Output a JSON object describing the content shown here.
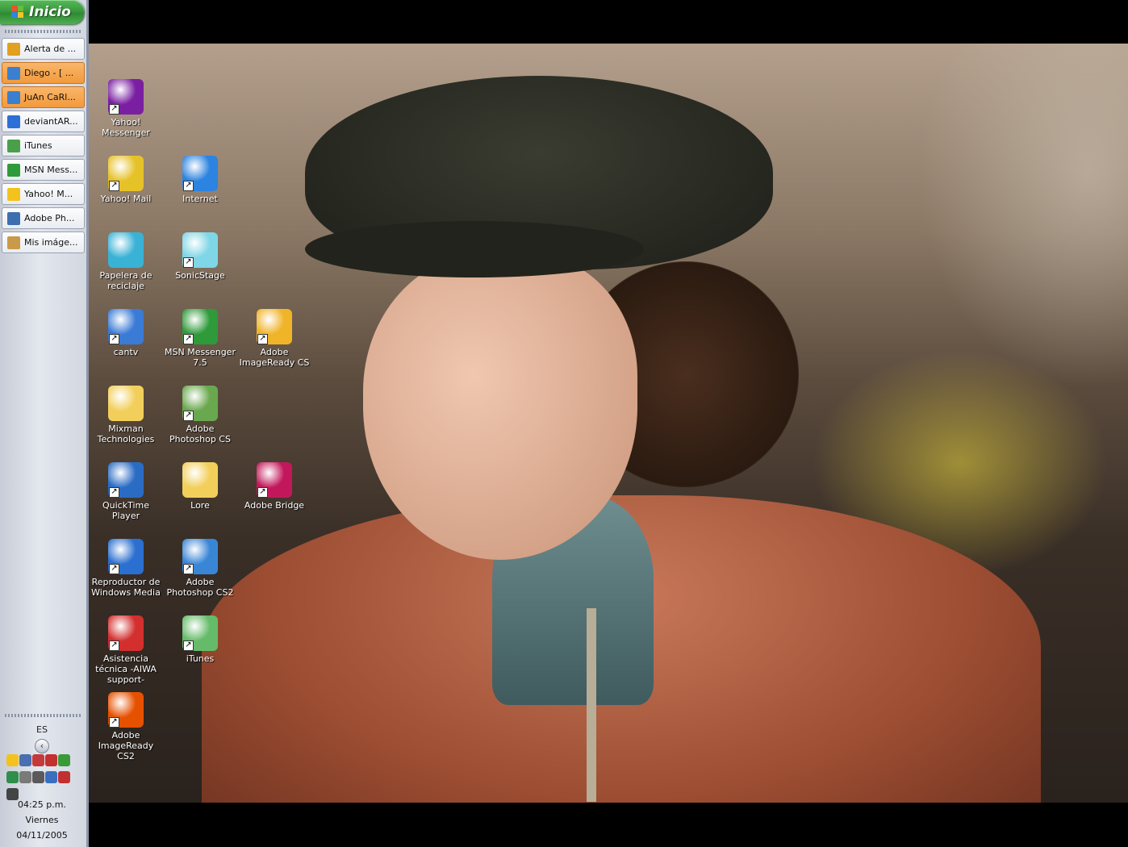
{
  "taskbar": {
    "start_label": "Inicio",
    "tasks": [
      {
        "label": "Alerta de ...",
        "icon": "alert-icon",
        "color": "#e0a020",
        "flash": false
      },
      {
        "label": "Diego - [ ...",
        "icon": "messenger-chat-icon",
        "color": "#3a7fd0",
        "flash": true
      },
      {
        "label": "JuAn CaRl...",
        "icon": "messenger-chat-icon",
        "color": "#3a7fd0",
        "flash": true
      },
      {
        "label": "deviantAR...",
        "icon": "internet-explorer-icon",
        "color": "#2c6fd6",
        "flash": false
      },
      {
        "label": "iTunes",
        "icon": "itunes-icon",
        "color": "#4aa04a",
        "flash": false
      },
      {
        "label": "MSN Mess...",
        "icon": "msn-messenger-icon",
        "color": "#2f9a3a",
        "flash": false
      },
      {
        "label": "Yahoo! M...",
        "icon": "yahoo-messenger-icon",
        "color": "#f4c21c",
        "flash": false
      },
      {
        "label": "Adobe Ph...",
        "icon": "photoshop-icon",
        "color": "#3d6fb0",
        "flash": false
      },
      {
        "label": "Mis imáge...",
        "icon": "picture-viewer-icon",
        "color": "#c89a4a",
        "flash": false
      }
    ],
    "language": "ES",
    "tray_arrow": "‹",
    "tray_icons": [
      {
        "name": "yahoo-tray-icon",
        "color": "#f4c21c"
      },
      {
        "name": "network-tray-icon",
        "color": "#4a6fb0"
      },
      {
        "name": "signal-tray-icon",
        "color": "#c43a3a"
      },
      {
        "name": "volume-muted-tray-icon",
        "color": "#c23030"
      },
      {
        "name": "msn-tray-icon",
        "color": "#3a9a3a"
      },
      {
        "name": "globe-tray-icon",
        "color": "#2f8f4a"
      },
      {
        "name": "cd-tray-icon",
        "color": "#7a7a7a"
      },
      {
        "name": "usb-tray-icon",
        "color": "#5a5a5a"
      },
      {
        "name": "search-tray-icon",
        "color": "#3a6fc0"
      },
      {
        "name": "antivirus-tray-icon",
        "color": "#c03030"
      },
      {
        "name": "printer-tray-icon",
        "color": "#444444"
      }
    ],
    "clock": {
      "time": "04:25 p.m.",
      "day": "Viernes",
      "date": "04/11/2005"
    }
  },
  "desktop": {
    "icons": [
      {
        "label": "Yahoo! Messenger",
        "icon": "yahoo-messenger-icon",
        "color": "#7b1fa2",
        "shortcut": true
      },
      {
        "label": "Yahoo! Mail",
        "icon": "yahoo-mail-icon",
        "color": "#e6c229",
        "shortcut": true
      },
      {
        "label": "Internet",
        "icon": "internet-explorer-icon",
        "color": "#2c83e0",
        "shortcut": true
      },
      {
        "label": "Papelera de reciclaje",
        "icon": "recycle-bin-icon",
        "color": "#39b2d6",
        "shortcut": false
      },
      {
        "label": "SonicStage",
        "icon": "sonicstage-icon",
        "color": "#7fd6e6",
        "shortcut": true
      },
      {
        "label": "cantv",
        "icon": "network-computer-icon",
        "color": "#3a7bd5",
        "shortcut": true
      },
      {
        "label": "MSN Messenger 7.5",
        "icon": "msn-messenger-icon",
        "color": "#2f9a3a",
        "shortcut": true
      },
      {
        "label": "Adobe ImageReady CS",
        "icon": "imageready-icon",
        "color": "#f0b429",
        "shortcut": true
      },
      {
        "label": "Mixman Technologies",
        "icon": "folder-icon",
        "color": "#f2cf5b",
        "shortcut": false
      },
      {
        "label": "Adobe Photoshop CS",
        "icon": "photoshop-icon",
        "color": "#6aa84f",
        "shortcut": true
      },
      {
        "label": "QuickTime Player",
        "icon": "quicktime-icon",
        "color": "#2a6cc4",
        "shortcut": true
      },
      {
        "label": "Lore",
        "icon": "folder-icon",
        "color": "#f2cf5b",
        "shortcut": false
      },
      {
        "label": "Adobe Bridge",
        "icon": "adobe-bridge-icon",
        "color": "#c2185b",
        "shortcut": true
      },
      {
        "label": "Reproductor de Windows Media",
        "icon": "windows-media-player-icon",
        "color": "#2b6fd0",
        "shortcut": true
      },
      {
        "label": "Adobe Photoshop CS2",
        "icon": "photoshop-icon",
        "color": "#3a86d6",
        "shortcut": true
      },
      {
        "label": "Asistencia técnica -AIWA support-",
        "icon": "aiwa-icon",
        "color": "#d32f2f",
        "shortcut": true
      },
      {
        "label": "iTunes",
        "icon": "itunes-icon",
        "color": "#66bb6a",
        "shortcut": true
      },
      {
        "label": "Adobe ImageReady CS2",
        "icon": "imageready-icon",
        "color": "#e65100",
        "shortcut": true
      }
    ]
  },
  "wallpaper": {
    "description_color": "#9c4d32"
  }
}
